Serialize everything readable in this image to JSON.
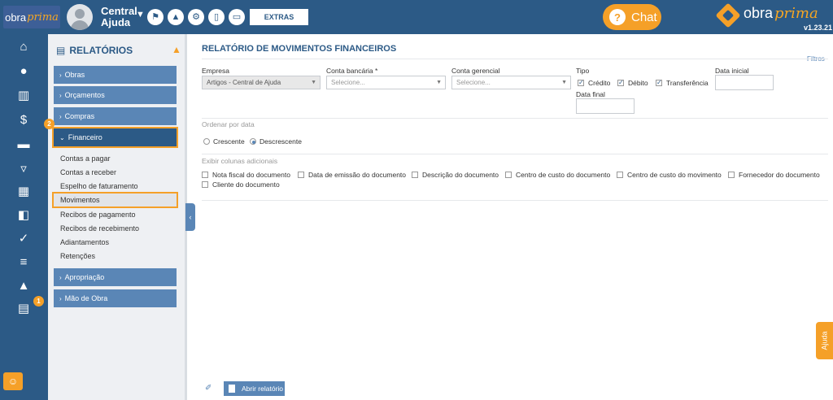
{
  "header": {
    "logo_text": "obra",
    "logo_accent": "prima",
    "user_name": "Central Ajuda",
    "extras_label": "EXTRAS",
    "chat_label": "Chat",
    "brand_text": "obra",
    "brand_accent": "prima",
    "version": "v1.23.21",
    "icons": [
      "flag-icon",
      "graduation-cap-icon",
      "gear-icon",
      "mobile-icon",
      "monitor-icon"
    ]
  },
  "rail": {
    "icons": [
      "home-icon",
      "user-icon",
      "building-icon",
      "dollar-doc-icon",
      "truck-icon",
      "cart-icon",
      "calculator-icon",
      "boxes-icon",
      "file-check-icon",
      "list-check-icon",
      "chart-mountain-icon",
      "document-icon"
    ],
    "badge_1": "1"
  },
  "sidebar": {
    "title": "RELATÓRIOS",
    "menu": [
      {
        "label": "Obras"
      },
      {
        "label": "Orçamentos"
      },
      {
        "label": "Compras"
      },
      {
        "label": "Financeiro"
      },
      {
        "label": "Apropriação"
      },
      {
        "label": "Mão de Obra"
      }
    ],
    "badge_2": "2",
    "sub_items": [
      "Contas a pagar",
      "Contas a receber",
      "Espelho de faturamento",
      "Movimentos",
      "Recibos de pagamento",
      "Recibos de recebimento",
      "Adiantamentos",
      "Retenções"
    ]
  },
  "main": {
    "title": "RELATÓRIO DE MOVIMENTOS FINANCEIROS",
    "filtros": "Filtros",
    "empresa_label": "Empresa",
    "empresa_value": "Artigos - Central de Ajuda",
    "conta_bancaria_label": "Conta bancária *",
    "conta_bancaria_placeholder": "Selecione...",
    "conta_gerencial_label": "Conta gerencial",
    "conta_gerencial_placeholder": "Selecione...",
    "tipo_label": "Tipo",
    "tipo_options": [
      "Crédito",
      "Débito",
      "Transferência"
    ],
    "data_inicial_label": "Data inicial",
    "data_final_label": "Data final",
    "ordenar_label": "Ordenar por data",
    "ordenar_options": [
      "Crescente",
      "Descrescente"
    ],
    "colunas_label": "Exibir colunas adicionais",
    "colunas_options": [
      "Nota fiscal do documento",
      "Data de emissão do documento",
      "Descrição do documento",
      "Centro de custo do documento",
      "Centro de custo do movimento",
      "Fornecedor do documento",
      "Cliente do documento"
    ],
    "abrir_label": "Abrir relatório",
    "ajuda_label": "Ajuda"
  }
}
